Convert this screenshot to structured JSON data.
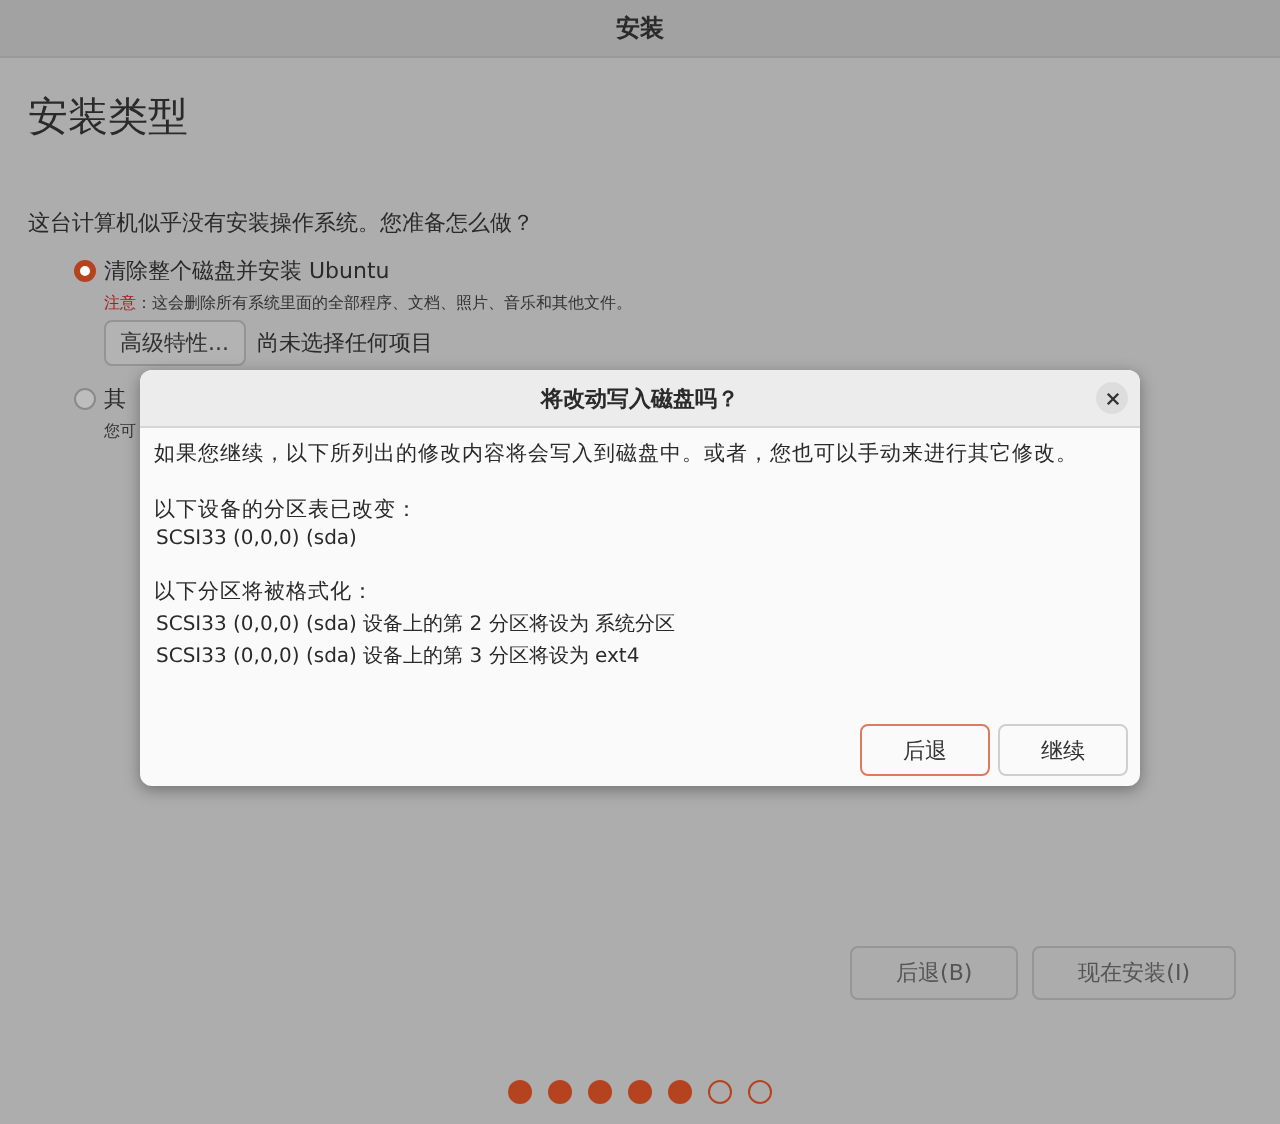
{
  "window": {
    "title": "安装"
  },
  "heading": "安装类型",
  "question": "这台计算机似乎没有安装操作系统。您准备怎么做？",
  "options": [
    {
      "label": "清除整个磁盘并安装 Ubuntu",
      "selected": true,
      "note_label": "注意",
      "note": "：这会删除所有系统里面的全部程序、文档、照片、音乐和其他文件。",
      "advanced_button": "高级特性...",
      "advanced_status": "尚未选择任何项目"
    },
    {
      "label": "其",
      "selected": false,
      "note": "您可"
    }
  ],
  "dialog": {
    "title": "将改动写入磁盘吗？",
    "intro": "如果您继续，以下所列出的修改内容将会写入到磁盘中。或者，您也可以手动来进行其它修改。",
    "sections": [
      {
        "heading": "以下设备的分区表已改变：",
        "lines": [
          "SCSI33 (0,0,0) (sda)"
        ]
      },
      {
        "heading": "以下分区将被格式化：",
        "lines": [
          "SCSI33 (0,0,0) (sda) 设备上的第 2 分区将设为 系统分区",
          "SCSI33 (0,0,0) (sda) 设备上的第 3 分区将设为 ext4"
        ]
      }
    ],
    "buttons": [
      {
        "label": "后退",
        "focused": true
      },
      {
        "label": "继续",
        "focused": false
      }
    ]
  },
  "nav_buttons": [
    "后退(B)",
    "现在安装(I)"
  ],
  "steps": [
    {
      "done": true
    },
    {
      "done": true
    },
    {
      "done": true
    },
    {
      "done": true
    },
    {
      "done": true
    },
    {
      "done": false
    },
    {
      "done": false
    }
  ]
}
